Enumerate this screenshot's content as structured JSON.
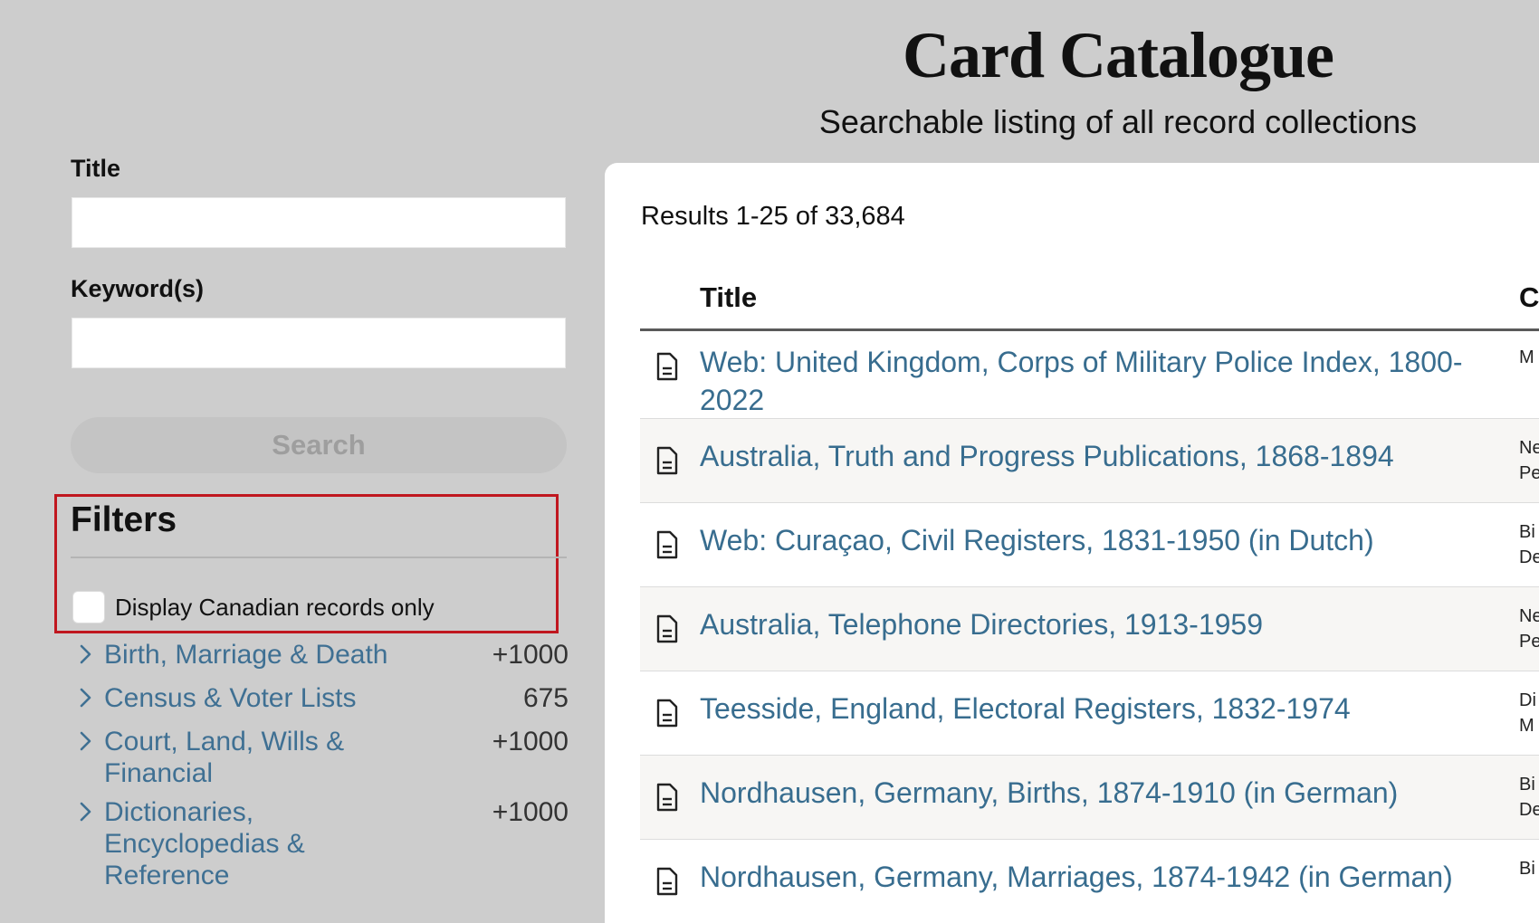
{
  "header": {
    "title": "Card Catalogue",
    "subtitle": "Searchable listing of all record collections"
  },
  "search_form": {
    "title_label": "Title",
    "title_value": "",
    "keywords_label": "Keyword(s)",
    "keywords_value": "",
    "search_button_label": "Search"
  },
  "filters": {
    "heading": "Filters",
    "canadian_only_label": "Display Canadian records only",
    "canadian_only_checked": false
  },
  "categories": [
    {
      "label": "Birth, Marriage & Death",
      "count": "+1000"
    },
    {
      "label": "Census & Voter Lists",
      "count": "675"
    },
    {
      "label": "Court, Land, Wills & Financial",
      "count": "+1000"
    },
    {
      "label": "Dictionaries, Encyclopedias & Reference",
      "count": "+1000"
    }
  ],
  "results": {
    "count_text": "Results 1-25 of 33,684",
    "columns": [
      "Title",
      "C"
    ],
    "rows": [
      {
        "title": "Web: United Kingdom, Corps of Military Police Index, 1800-2022",
        "category": "M"
      },
      {
        "title": "Australia, Truth and Progress Publications, 1868-1894",
        "category": "Ne\nPe"
      },
      {
        "title": "Web: Curaçao, Civil Registers, 1831-1950 (in Dutch)",
        "category": "Bi\nDe"
      },
      {
        "title": "Australia, Telephone Directories, 1913-1959",
        "category": "Ne\nPe"
      },
      {
        "title": "Teesside, England, Electoral Registers, 1832-1974",
        "category": "Di\nM"
      },
      {
        "title": "Nordhausen, Germany, Births, 1874-1910 (in German)",
        "category": "Bi\nDe"
      },
      {
        "title": "Nordhausen, Germany, Marriages, 1874-1942 (in German)",
        "category": "Bi"
      }
    ]
  },
  "colors": {
    "background": "#cdcdcd",
    "link": "#386d8f",
    "highlight_border": "#c0171f",
    "row_alt": "#f7f6f4"
  },
  "icons": {
    "category_toggle": "chevron-right-icon",
    "result_type": "document-icon"
  }
}
